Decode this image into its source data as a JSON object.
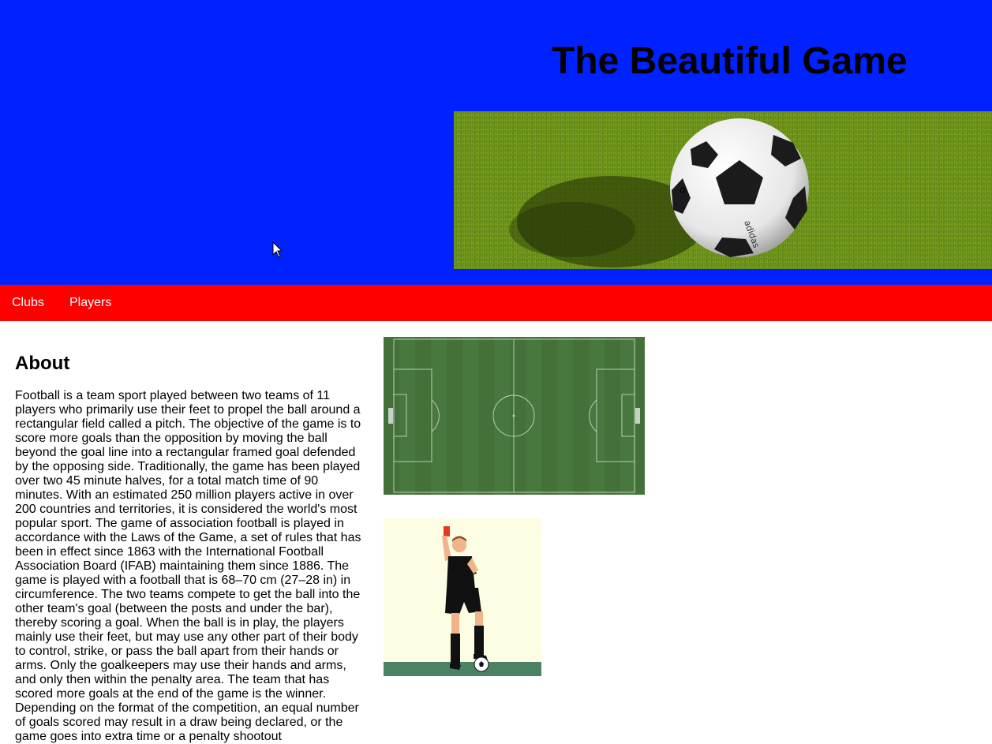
{
  "header": {
    "title": "The Beautiful Game",
    "background_color": "#0022ff",
    "hero_image": "soccer-ball-on-grass"
  },
  "nav": {
    "background_color": "#ff0000",
    "items": [
      {
        "label": "Clubs"
      },
      {
        "label": "Players"
      }
    ]
  },
  "about": {
    "heading": "About",
    "body": "Football is a team sport played between two teams of 11 players who primarily use their feet to propel the ball around a rectangular field called a pitch. The objective of the game is to score more goals than the opposition by moving the ball beyond the goal line into a rectangular framed goal defended by the opposing side. Traditionally, the game has been played over two 45 minute halves, for a total match time of 90 minutes. With an estimated 250 million players active in over 200 countries and territories, it is considered the world's most popular sport. The game of association football is played in accordance with the Laws of the Game, a set of rules that has been in effect since 1863 with the International Football Association Board (IFAB) maintaining them since 1886. The game is played with a football that is 68–70 cm (27–28 in) in circumference. The two teams compete to get the ball into the other team's goal (between the posts and under the bar), thereby scoring a goal. When the ball is in play, the players mainly use their feet, but may use any other part of their body to control, strike, or pass the ball apart from their hands or arms. Only the goalkeepers may use their hands and arms, and only then within the penalty area. The team that has scored more goals at the end of the game is the winner. Depending on the format of the competition, an equal number of goals scored may result in a draw being declared, or the game goes into extra time or a penalty shootout"
  },
  "images": {
    "pitch": "aerial-football-pitch",
    "referee": "referee-with-red-card"
  }
}
